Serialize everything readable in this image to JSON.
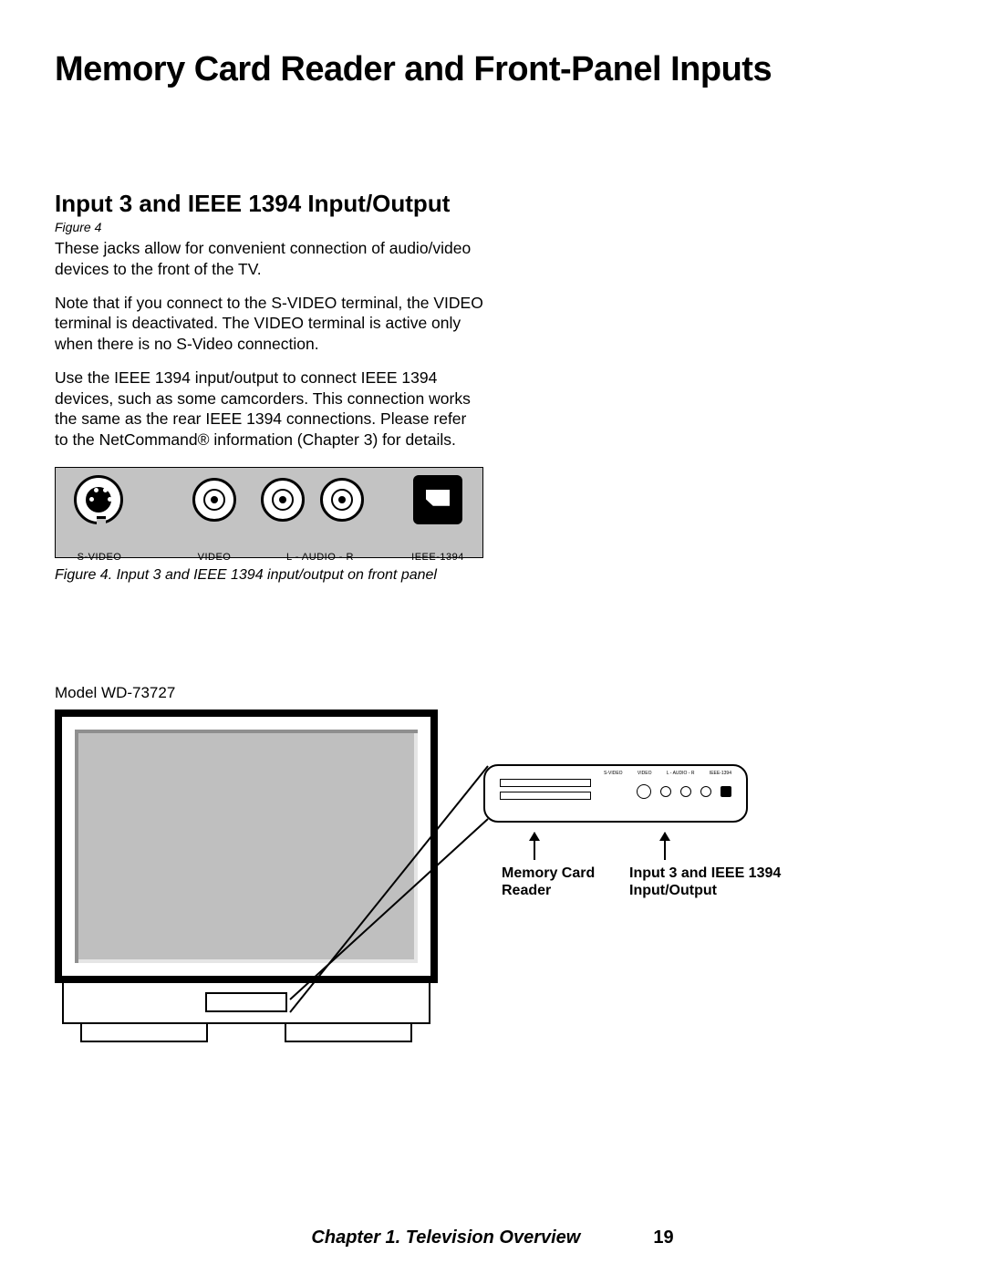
{
  "page": {
    "title": "Memory Card Reader and Front-Panel Inputs",
    "footer_chapter": "Chapter 1. Television Overview",
    "footer_page": "19"
  },
  "section": {
    "heading": "Input 3 and IEEE 1394 Input/Output",
    "figure_ref": "Figure 4",
    "paragraphs": [
      "These jacks allow for convenient connection of audio/video devices to the front of the TV.",
      "Note that if you connect to the S-VIDEO terminal, the VIDEO terminal is deactivated.  The VIDEO terminal is active only when there is no S-Video connection.",
      "Use the IEEE 1394 input/output to connect IEEE 1394 devices, such as some camcorders.  This connection works the same as the rear IEEE 1394 connections.  Please refer to the NetCommand® information (Chapter 3) for details."
    ]
  },
  "figure4": {
    "labels": {
      "svideo": "S-VIDEO",
      "video": "VIDEO",
      "audio": "L   -   AUDIO   -   R",
      "ieee": "IEEE-1394"
    },
    "caption": "Figure 4.  Input 3 and IEEE 1394 input/output on front panel"
  },
  "tv": {
    "model_label": "Model WD-73727"
  },
  "callouts": {
    "memory_card": "Memory Card Reader",
    "input3": "Input 3 and IEEE 1394 Input/Output",
    "panel_tiny_labels": [
      "S-VIDEO",
      "VIDEO",
      "L - AUDIO - R",
      "IEEE-1394"
    ]
  }
}
